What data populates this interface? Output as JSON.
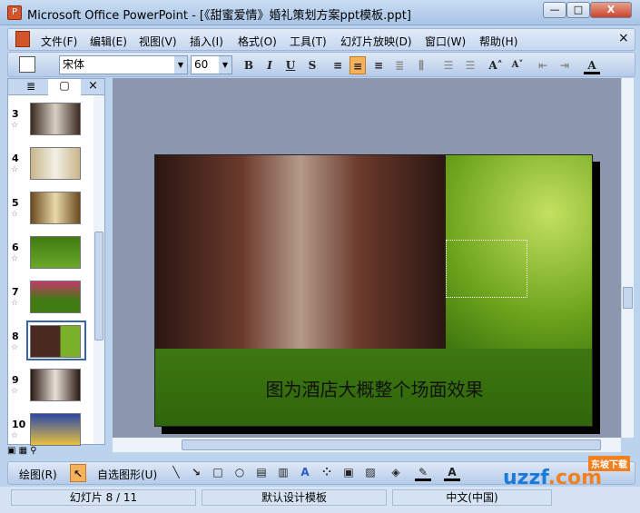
{
  "window": {
    "title": "Microsoft Office PowerPoint - [《甜蜜爱情》婚礼策划方案ppt模板.ppt]",
    "minimize": "—",
    "maximize": "□",
    "close": "X"
  },
  "menu": [
    "文件(F)",
    "编辑(E)",
    "视图(V)",
    "插入(I)",
    "格式(O)",
    "工具(T)",
    "幻灯片放映(D)",
    "窗口(W)",
    "帮助(H)"
  ],
  "menu_close": "×",
  "toolbar": {
    "font": "宋体",
    "size": "60",
    "bold": "B",
    "italic": "I",
    "underline": "U",
    "shadow": "S",
    "font_color": "A"
  },
  "pane": {
    "close": "×",
    "slides": [
      {
        "n": "3"
      },
      {
        "n": "4"
      },
      {
        "n": "5"
      },
      {
        "n": "6"
      },
      {
        "n": "7"
      },
      {
        "n": "8",
        "selected": true
      },
      {
        "n": "9"
      },
      {
        "n": "10"
      }
    ]
  },
  "slide": {
    "caption": "图为酒店大概整个场面效果"
  },
  "drawing": {
    "draw": "绘图(R)",
    "autoshapes": "自选图形(U)"
  },
  "status": {
    "slide": "幻灯片 8 / 11",
    "template": "默认设计模板",
    "language": "中文(中国)"
  },
  "watermark": "uzzf.com 东坡下载",
  "colors": {
    "accent": "#f7b15a",
    "titlebar": "#b9d0ec"
  }
}
